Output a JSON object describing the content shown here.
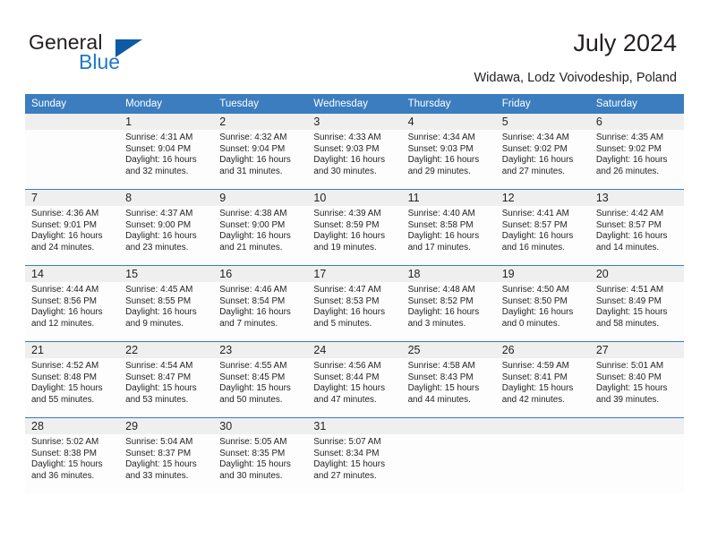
{
  "brand": {
    "name_top": "General",
    "name_bottom": "Blue",
    "triangle_color": "#0d5ba5",
    "blue_color": "#1f7ac4"
  },
  "header": {
    "title": "July 2024",
    "subtitle": "Widawa, Lodz Voivodeship, Poland"
  },
  "theme": {
    "header_bg": "#3b7dbf",
    "daynum_bg": "#efefef",
    "cell_bg": "#fdfdfd",
    "text": "#231f20"
  },
  "calendar": {
    "weekday_headers": [
      "Sunday",
      "Monday",
      "Tuesday",
      "Wednesday",
      "Thursday",
      "Friday",
      "Saturday"
    ],
    "labels": {
      "sunrise": "Sunrise:",
      "sunset": "Sunset:",
      "daylight": "Daylight:"
    },
    "weeks": [
      [
        {
          "day": "",
          "blank": true,
          "sunrise": "",
          "sunset": "",
          "daylight_line1": "",
          "daylight_line2": ""
        },
        {
          "day": "1",
          "sunrise": "Sunrise: 4:31 AM",
          "sunset": "Sunset: 9:04 PM",
          "daylight_line1": "Daylight: 16 hours",
          "daylight_line2": "and 32 minutes."
        },
        {
          "day": "2",
          "sunrise": "Sunrise: 4:32 AM",
          "sunset": "Sunset: 9:04 PM",
          "daylight_line1": "Daylight: 16 hours",
          "daylight_line2": "and 31 minutes."
        },
        {
          "day": "3",
          "sunrise": "Sunrise: 4:33 AM",
          "sunset": "Sunset: 9:03 PM",
          "daylight_line1": "Daylight: 16 hours",
          "daylight_line2": "and 30 minutes."
        },
        {
          "day": "4",
          "sunrise": "Sunrise: 4:34 AM",
          "sunset": "Sunset: 9:03 PM",
          "daylight_line1": "Daylight: 16 hours",
          "daylight_line2": "and 29 minutes."
        },
        {
          "day": "5",
          "sunrise": "Sunrise: 4:34 AM",
          "sunset": "Sunset: 9:02 PM",
          "daylight_line1": "Daylight: 16 hours",
          "daylight_line2": "and 27 minutes."
        },
        {
          "day": "6",
          "sunrise": "Sunrise: 4:35 AM",
          "sunset": "Sunset: 9:02 PM",
          "daylight_line1": "Daylight: 16 hours",
          "daylight_line2": "and 26 minutes."
        }
      ],
      [
        {
          "day": "7",
          "sunrise": "Sunrise: 4:36 AM",
          "sunset": "Sunset: 9:01 PM",
          "daylight_line1": "Daylight: 16 hours",
          "daylight_line2": "and 24 minutes."
        },
        {
          "day": "8",
          "sunrise": "Sunrise: 4:37 AM",
          "sunset": "Sunset: 9:00 PM",
          "daylight_line1": "Daylight: 16 hours",
          "daylight_line2": "and 23 minutes."
        },
        {
          "day": "9",
          "sunrise": "Sunrise: 4:38 AM",
          "sunset": "Sunset: 9:00 PM",
          "daylight_line1": "Daylight: 16 hours",
          "daylight_line2": "and 21 minutes."
        },
        {
          "day": "10",
          "sunrise": "Sunrise: 4:39 AM",
          "sunset": "Sunset: 8:59 PM",
          "daylight_line1": "Daylight: 16 hours",
          "daylight_line2": "and 19 minutes."
        },
        {
          "day": "11",
          "sunrise": "Sunrise: 4:40 AM",
          "sunset": "Sunset: 8:58 PM",
          "daylight_line1": "Daylight: 16 hours",
          "daylight_line2": "and 17 minutes."
        },
        {
          "day": "12",
          "sunrise": "Sunrise: 4:41 AM",
          "sunset": "Sunset: 8:57 PM",
          "daylight_line1": "Daylight: 16 hours",
          "daylight_line2": "and 16 minutes."
        },
        {
          "day": "13",
          "sunrise": "Sunrise: 4:42 AM",
          "sunset": "Sunset: 8:57 PM",
          "daylight_line1": "Daylight: 16 hours",
          "daylight_line2": "and 14 minutes."
        }
      ],
      [
        {
          "day": "14",
          "sunrise": "Sunrise: 4:44 AM",
          "sunset": "Sunset: 8:56 PM",
          "daylight_line1": "Daylight: 16 hours",
          "daylight_line2": "and 12 minutes."
        },
        {
          "day": "15",
          "sunrise": "Sunrise: 4:45 AM",
          "sunset": "Sunset: 8:55 PM",
          "daylight_line1": "Daylight: 16 hours",
          "daylight_line2": "and 9 minutes."
        },
        {
          "day": "16",
          "sunrise": "Sunrise: 4:46 AM",
          "sunset": "Sunset: 8:54 PM",
          "daylight_line1": "Daylight: 16 hours",
          "daylight_line2": "and 7 minutes."
        },
        {
          "day": "17",
          "sunrise": "Sunrise: 4:47 AM",
          "sunset": "Sunset: 8:53 PM",
          "daylight_line1": "Daylight: 16 hours",
          "daylight_line2": "and 5 minutes."
        },
        {
          "day": "18",
          "sunrise": "Sunrise: 4:48 AM",
          "sunset": "Sunset: 8:52 PM",
          "daylight_line1": "Daylight: 16 hours",
          "daylight_line2": "and 3 minutes."
        },
        {
          "day": "19",
          "sunrise": "Sunrise: 4:50 AM",
          "sunset": "Sunset: 8:50 PM",
          "daylight_line1": "Daylight: 16 hours",
          "daylight_line2": "and 0 minutes."
        },
        {
          "day": "20",
          "sunrise": "Sunrise: 4:51 AM",
          "sunset": "Sunset: 8:49 PM",
          "daylight_line1": "Daylight: 15 hours",
          "daylight_line2": "and 58 minutes."
        }
      ],
      [
        {
          "day": "21",
          "sunrise": "Sunrise: 4:52 AM",
          "sunset": "Sunset: 8:48 PM",
          "daylight_line1": "Daylight: 15 hours",
          "daylight_line2": "and 55 minutes."
        },
        {
          "day": "22",
          "sunrise": "Sunrise: 4:54 AM",
          "sunset": "Sunset: 8:47 PM",
          "daylight_line1": "Daylight: 15 hours",
          "daylight_line2": "and 53 minutes."
        },
        {
          "day": "23",
          "sunrise": "Sunrise: 4:55 AM",
          "sunset": "Sunset: 8:45 PM",
          "daylight_line1": "Daylight: 15 hours",
          "daylight_line2": "and 50 minutes."
        },
        {
          "day": "24",
          "sunrise": "Sunrise: 4:56 AM",
          "sunset": "Sunset: 8:44 PM",
          "daylight_line1": "Daylight: 15 hours",
          "daylight_line2": "and 47 minutes."
        },
        {
          "day": "25",
          "sunrise": "Sunrise: 4:58 AM",
          "sunset": "Sunset: 8:43 PM",
          "daylight_line1": "Daylight: 15 hours",
          "daylight_line2": "and 44 minutes."
        },
        {
          "day": "26",
          "sunrise": "Sunrise: 4:59 AM",
          "sunset": "Sunset: 8:41 PM",
          "daylight_line1": "Daylight: 15 hours",
          "daylight_line2": "and 42 minutes."
        },
        {
          "day": "27",
          "sunrise": "Sunrise: 5:01 AM",
          "sunset": "Sunset: 8:40 PM",
          "daylight_line1": "Daylight: 15 hours",
          "daylight_line2": "and 39 minutes."
        }
      ],
      [
        {
          "day": "28",
          "sunrise": "Sunrise: 5:02 AM",
          "sunset": "Sunset: 8:38 PM",
          "daylight_line1": "Daylight: 15 hours",
          "daylight_line2": "and 36 minutes."
        },
        {
          "day": "29",
          "sunrise": "Sunrise: 5:04 AM",
          "sunset": "Sunset: 8:37 PM",
          "daylight_line1": "Daylight: 15 hours",
          "daylight_line2": "and 33 minutes."
        },
        {
          "day": "30",
          "sunrise": "Sunrise: 5:05 AM",
          "sunset": "Sunset: 8:35 PM",
          "daylight_line1": "Daylight: 15 hours",
          "daylight_line2": "and 30 minutes."
        },
        {
          "day": "31",
          "sunrise": "Sunrise: 5:07 AM",
          "sunset": "Sunset: 8:34 PM",
          "daylight_line1": "Daylight: 15 hours",
          "daylight_line2": "and 27 minutes."
        },
        {
          "day": "",
          "blank": true,
          "sunrise": "",
          "sunset": "",
          "daylight_line1": "",
          "daylight_line2": ""
        },
        {
          "day": "",
          "blank": true,
          "sunrise": "",
          "sunset": "",
          "daylight_line1": "",
          "daylight_line2": ""
        },
        {
          "day": "",
          "blank": true,
          "sunrise": "",
          "sunset": "",
          "daylight_line1": "",
          "daylight_line2": ""
        }
      ]
    ]
  }
}
